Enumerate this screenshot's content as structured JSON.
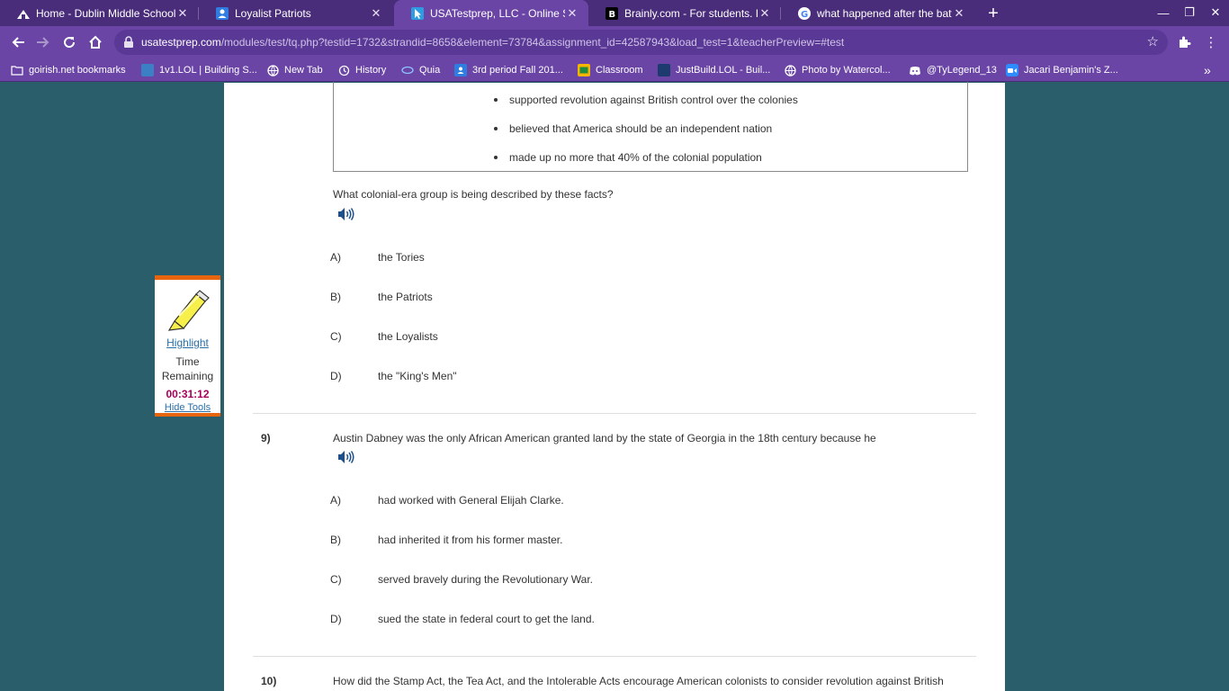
{
  "browser": {
    "tabs": [
      {
        "title": "Home - Dublin Middle School",
        "icon": "school-icon",
        "active": false
      },
      {
        "title": "Loyalist Patriots",
        "icon": "person-icon",
        "active": false
      },
      {
        "title": "USATestprep, LLC - Online State-",
        "icon": "cursor-icon",
        "active": true
      },
      {
        "title": "Brainly.com - For students. By st",
        "icon": "brainly-icon",
        "active": false
      },
      {
        "title": "what happened after the battle o",
        "icon": "google-icon",
        "active": false
      }
    ],
    "url_host": "usatestprep.com",
    "url_path": "/modules/test/tq.php?testid=1732&strandid=8658&element=73784&assignment_id=42587943&load_test=1&teacherPreview=#test",
    "bookmarks": [
      {
        "label": "goirish.net bookmarks",
        "icon": "folder-icon"
      },
      {
        "label": "1v1.LOL | Building S...",
        "icon": "game-icon"
      },
      {
        "label": "New Tab",
        "icon": "globe-icon"
      },
      {
        "label": "History",
        "icon": "history-icon"
      },
      {
        "label": "Quia",
        "icon": "quia-icon"
      },
      {
        "label": "3rd period Fall 201...",
        "icon": "person-icon"
      },
      {
        "label": "Classroom",
        "icon": "classroom-icon"
      },
      {
        "label": "JustBuild.LOL - Buil...",
        "icon": "game-icon"
      },
      {
        "label": "Photo by Watercol...",
        "icon": "globe-icon"
      },
      {
        "label": "@TyLegend_13",
        "icon": "discord-icon"
      },
      {
        "label": "Jacari Benjamin's Z...",
        "icon": "zoom-icon"
      }
    ],
    "colors": {
      "frame": "#4a2d7a",
      "toolbar": "#6a45a6",
      "page_bg": "#2a5e6b",
      "accent": "#e8650f"
    }
  },
  "passage": {
    "bullets": [
      "supported revolution against British control over the colonies",
      "believed that America should be an independent nation",
      "made up no more that 40% of the colonial population"
    ]
  },
  "q8": {
    "text": "What colonial-era group is being described by these facts?",
    "options": [
      {
        "letter": "A)",
        "text": "the Tories"
      },
      {
        "letter": "B)",
        "text": "the Patriots"
      },
      {
        "letter": "C)",
        "text": "the Loyalists"
      },
      {
        "letter": "D)",
        "text": "the \"King's Men\""
      }
    ]
  },
  "q9": {
    "number": "9)",
    "text": "Austin Dabney was the only African American granted land by the state of Georgia in the 18th century because he",
    "options": [
      {
        "letter": "A)",
        "text": "had worked with General Elijah Clarke."
      },
      {
        "letter": "B)",
        "text": "had inherited it from his former master."
      },
      {
        "letter": "C)",
        "text": "served bravely during the Revolutionary War."
      },
      {
        "letter": "D)",
        "text": "sued the state in federal court to get the land."
      }
    ]
  },
  "q10": {
    "number": "10)",
    "text": "How did the Stamp Act, the Tea Act, and the Intolerable Acts encourage American colonists to consider revolution against British"
  },
  "tools": {
    "highlight_label": "Highlight",
    "time_label": "Time Remaining",
    "time_value": "00:31:12",
    "hide_label": "Hide Tools"
  }
}
